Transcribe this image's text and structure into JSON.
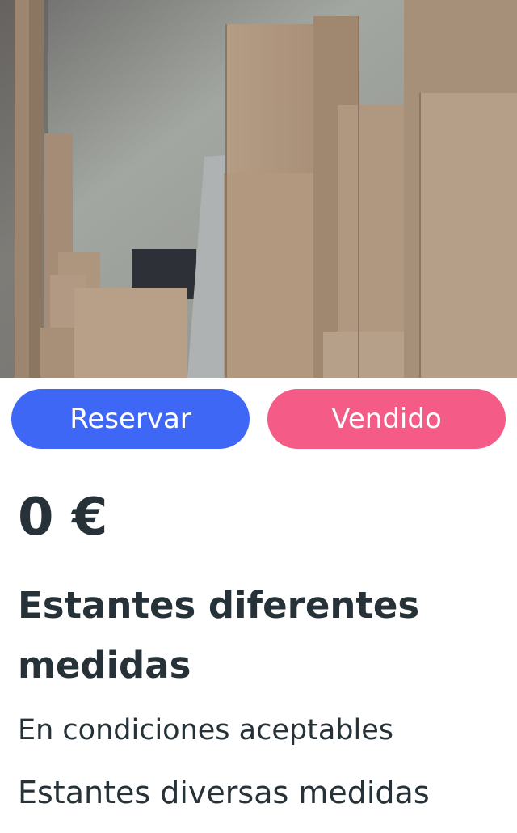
{
  "listing": {
    "photo_subject": "wooden-shelves-photo",
    "price": "0 €",
    "title": "Estantes diferentes medidas",
    "condition": "En condiciones aceptables",
    "description": "Estantes diversas medidas"
  },
  "actions": {
    "reserve_label": "Reservar",
    "sold_label": "Vendido"
  },
  "colors": {
    "reserve": "#3f67f5",
    "sold": "#f45b86",
    "text": "#263238"
  }
}
